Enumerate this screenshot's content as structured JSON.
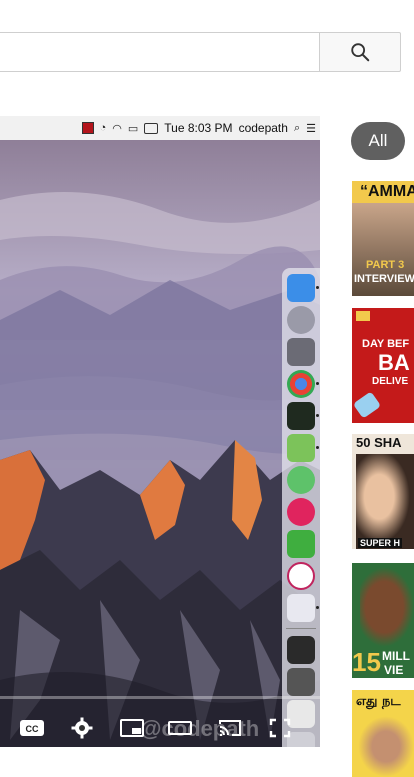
{
  "search": {
    "value": "",
    "placeholder": "",
    "button_icon": "search-icon"
  },
  "menubar": {
    "time": "Tue 8:03 PM",
    "user": "codepath"
  },
  "controls": {
    "watermark": "@codepath",
    "icons": [
      "captions-icon",
      "settings-icon",
      "miniplayer-icon",
      "theater-mode-icon",
      "cast-icon",
      "fullscreen-icon"
    ]
  },
  "chips": {
    "all_label": "All"
  },
  "thumbnails": [
    {
      "line1": "“AMMA",
      "line2": "PART 3",
      "line3": "INTERVIEW",
      "bg": "#f2c94c"
    },
    {
      "line1": "DAY BEF",
      "line2": "BA",
      "line3": "DELIVE",
      "bg": "#c41a1a"
    },
    {
      "line1": "50 SHA",
      "line2": "SUPER H",
      "line3": "",
      "bg": "#efe6da"
    },
    {
      "line1": "15",
      "line2": "MILL",
      "line3": "VIE",
      "bg": "#d93a2b"
    },
    {
      "line1": "எது நட",
      "line2": "",
      "line3": "",
      "bg": "#f4d44a"
    }
  ],
  "colors": {
    "chip_bg": "#606060",
    "sky_top": "#8f7f98",
    "mountain_glow": "#e07a40"
  }
}
